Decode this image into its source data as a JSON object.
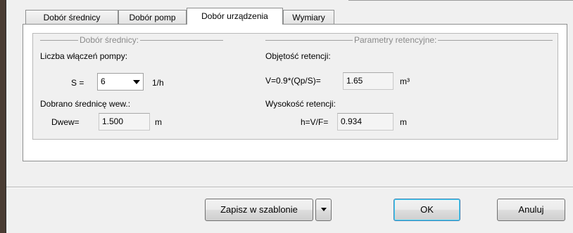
{
  "tabs": [
    {
      "label": "Dobór średnicy",
      "active": false
    },
    {
      "label": "Dobór pomp",
      "active": false
    },
    {
      "label": "Dobór urządzenia",
      "active": true
    },
    {
      "label": "Wymiary",
      "active": false
    }
  ],
  "group_left": {
    "legend": "Dobór średnicy:",
    "pump_count_label": "Liczba włączeń pompy:",
    "s_prefix": "S =",
    "s_value": "6",
    "s_unit": "1/h",
    "diameter_label": "Dobrano średnicę wew.:",
    "dwew_prefix": "Dwew=",
    "dwew_value": "1.500",
    "dwew_unit": "m"
  },
  "group_right": {
    "legend": "Parametry retencyjne:",
    "volume_label": "Objętość retencji:",
    "v_prefix": "V=0.9*(Qp/S)=",
    "v_value": "1.65",
    "v_unit": "m³",
    "height_label": "Wysokość retencji:",
    "h_prefix": "h=V/F=",
    "h_value": "0.934",
    "h_unit": "m"
  },
  "buttons": {
    "save_template": "Zapisz w szablonie",
    "ok": "OK",
    "cancel": "Anuluj"
  },
  "colors": {
    "window_bg": "#f0f0f0",
    "frame": "#4a3c33",
    "default_button_border": "#3c7fb1"
  }
}
